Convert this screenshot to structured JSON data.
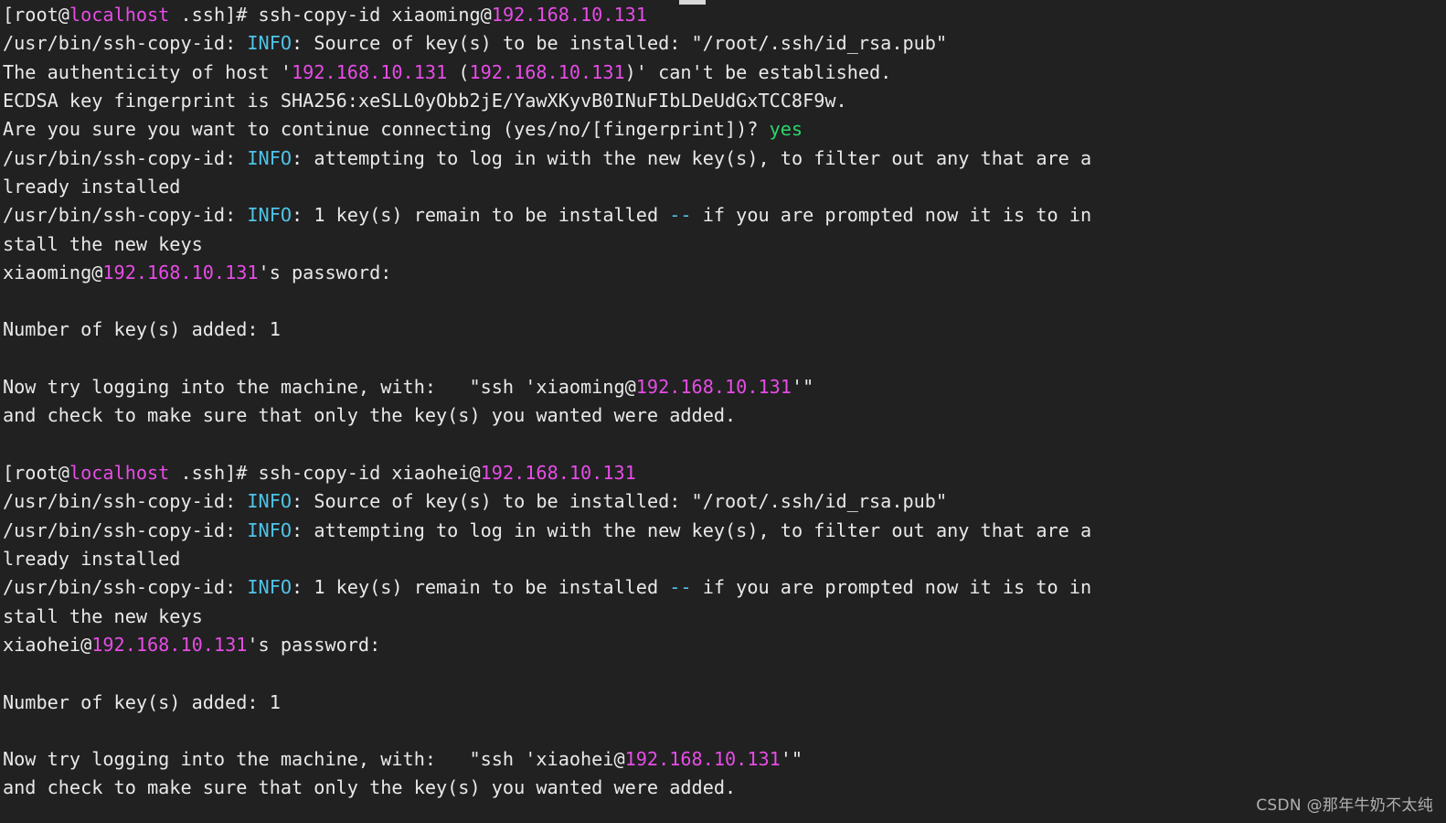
{
  "terminal": {
    "background_color": "#212121",
    "foreground_color": "#e9e9e9",
    "colors": {
      "cyan": "#4fc3e8",
      "magenta": "#e64ce6",
      "green": "#2ad66a",
      "white": "#e9e9e9"
    },
    "prompt_user": "root",
    "prompt_host": "localhost",
    "prompt_dir": ".ssh",
    "lines": [
      {
        "id": "line-01",
        "kind": "prompt-command",
        "segments": [
          {
            "text": "[root@",
            "color": "default"
          },
          {
            "text": "localhost",
            "color": "magenta"
          },
          {
            "text": " .ssh]# ssh-copy-id xiaoming@",
            "color": "default"
          },
          {
            "text": "192.168.10.131",
            "color": "magenta"
          }
        ]
      },
      {
        "id": "line-02",
        "kind": "output",
        "segments": [
          {
            "text": "/usr/bin/ssh-copy-id: ",
            "color": "default"
          },
          {
            "text": "INFO",
            "color": "cyan"
          },
          {
            "text": ": Source of key(s) to be installed: \"/root/.ssh/id_rsa.pub\"",
            "color": "default"
          }
        ]
      },
      {
        "id": "line-03",
        "kind": "output",
        "segments": [
          {
            "text": "The authenticity of host '",
            "color": "default"
          },
          {
            "text": "192.168.10.131",
            "color": "magenta"
          },
          {
            "text": " (",
            "color": "default"
          },
          {
            "text": "192.168.10.131",
            "color": "magenta"
          },
          {
            "text": ")' can't be established.",
            "color": "default"
          }
        ]
      },
      {
        "id": "line-04",
        "kind": "output",
        "segments": [
          {
            "text": "ECDSA key fingerprint is SHA256:xeSLL0yObb2jE/YawXKyvB0INuFIbLDeUdGxTCC8F9w.",
            "color": "default"
          }
        ]
      },
      {
        "id": "line-05",
        "kind": "prompt-question",
        "segments": [
          {
            "text": "Are you sure you want to continue connecting (yes/no/[fingerprint])? ",
            "color": "default"
          },
          {
            "text": "yes",
            "color": "green"
          }
        ]
      },
      {
        "id": "line-06",
        "kind": "output",
        "segments": [
          {
            "text": "/usr/bin/ssh-copy-id: ",
            "color": "default"
          },
          {
            "text": "INFO",
            "color": "cyan"
          },
          {
            "text": ": attempting to log in with the new key(s), to filter out any that are a",
            "color": "default"
          }
        ]
      },
      {
        "id": "line-07",
        "kind": "output-wrap",
        "segments": [
          {
            "text": "lready installed",
            "color": "default"
          }
        ]
      },
      {
        "id": "line-08",
        "kind": "output",
        "segments": [
          {
            "text": "/usr/bin/ssh-copy-id: ",
            "color": "default"
          },
          {
            "text": "INFO",
            "color": "cyan"
          },
          {
            "text": ": 1 key(s) remain to be installed ",
            "color": "default"
          },
          {
            "text": "--",
            "color": "cyan"
          },
          {
            "text": " if you are prompted now it is to in",
            "color": "default"
          }
        ]
      },
      {
        "id": "line-09",
        "kind": "output-wrap",
        "segments": [
          {
            "text": "stall the new keys",
            "color": "default"
          }
        ]
      },
      {
        "id": "line-10",
        "kind": "password-prompt",
        "segments": [
          {
            "text": "xiaoming@",
            "color": "default"
          },
          {
            "text": "192.168.10.131",
            "color": "magenta"
          },
          {
            "text": "'s password: ",
            "color": "default"
          }
        ]
      },
      {
        "id": "line-11",
        "kind": "blank",
        "segments": []
      },
      {
        "id": "line-12",
        "kind": "output",
        "segments": [
          {
            "text": "Number of key(s) added: 1",
            "color": "default"
          }
        ]
      },
      {
        "id": "line-13",
        "kind": "blank",
        "segments": []
      },
      {
        "id": "line-14",
        "kind": "output",
        "segments": [
          {
            "text": "Now try logging into the machine, with:   \"ssh 'xiaoming@",
            "color": "default"
          },
          {
            "text": "192.168.10.131",
            "color": "magenta"
          },
          {
            "text": "'\"",
            "color": "default"
          }
        ]
      },
      {
        "id": "line-15",
        "kind": "output",
        "segments": [
          {
            "text": "and check to make sure that only the key(s) you wanted were added.",
            "color": "default"
          }
        ]
      },
      {
        "id": "line-16",
        "kind": "blank",
        "segments": []
      },
      {
        "id": "line-17",
        "kind": "prompt-command",
        "segments": [
          {
            "text": "[root@",
            "color": "default"
          },
          {
            "text": "localhost",
            "color": "magenta"
          },
          {
            "text": " .ssh]# ssh-copy-id xiaohei@",
            "color": "default"
          },
          {
            "text": "192.168.10.131",
            "color": "magenta"
          }
        ]
      },
      {
        "id": "line-18",
        "kind": "output",
        "segments": [
          {
            "text": "/usr/bin/ssh-copy-id: ",
            "color": "default"
          },
          {
            "text": "INFO",
            "color": "cyan"
          },
          {
            "text": ": Source of key(s) to be installed: \"/root/.ssh/id_rsa.pub\"",
            "color": "default"
          }
        ]
      },
      {
        "id": "line-19",
        "kind": "output",
        "segments": [
          {
            "text": "/usr/bin/ssh-copy-id: ",
            "color": "default"
          },
          {
            "text": "INFO",
            "color": "cyan"
          },
          {
            "text": ": attempting to log in with the new key(s), to filter out any that are a",
            "color": "default"
          }
        ]
      },
      {
        "id": "line-20",
        "kind": "output-wrap",
        "segments": [
          {
            "text": "lready installed",
            "color": "default"
          }
        ]
      },
      {
        "id": "line-21",
        "kind": "output",
        "segments": [
          {
            "text": "/usr/bin/ssh-copy-id: ",
            "color": "default"
          },
          {
            "text": "INFO",
            "color": "cyan"
          },
          {
            "text": ": 1 key(s) remain to be installed ",
            "color": "default"
          },
          {
            "text": "--",
            "color": "cyan"
          },
          {
            "text": " if you are prompted now it is to in",
            "color": "default"
          }
        ]
      },
      {
        "id": "line-22",
        "kind": "output-wrap",
        "segments": [
          {
            "text": "stall the new keys",
            "color": "default"
          }
        ]
      },
      {
        "id": "line-23",
        "kind": "password-prompt",
        "segments": [
          {
            "text": "xiaohei@",
            "color": "default"
          },
          {
            "text": "192.168.10.131",
            "color": "magenta"
          },
          {
            "text": "'s password: ",
            "color": "default"
          }
        ]
      },
      {
        "id": "line-24",
        "kind": "blank",
        "segments": []
      },
      {
        "id": "line-25",
        "kind": "output",
        "segments": [
          {
            "text": "Number of key(s) added: 1",
            "color": "default"
          }
        ]
      },
      {
        "id": "line-26",
        "kind": "blank",
        "segments": []
      },
      {
        "id": "line-27",
        "kind": "output",
        "segments": [
          {
            "text": "Now try logging into the machine, with:   \"ssh 'xiaohei@",
            "color": "default"
          },
          {
            "text": "192.168.10.131",
            "color": "magenta"
          },
          {
            "text": "'\"",
            "color": "default"
          }
        ]
      },
      {
        "id": "line-28",
        "kind": "output",
        "segments": [
          {
            "text": "and check to make sure that only the key(s) you wanted were added.",
            "color": "default"
          }
        ]
      }
    ]
  },
  "watermark": {
    "text": "CSDN @那年牛奶不太纯"
  }
}
